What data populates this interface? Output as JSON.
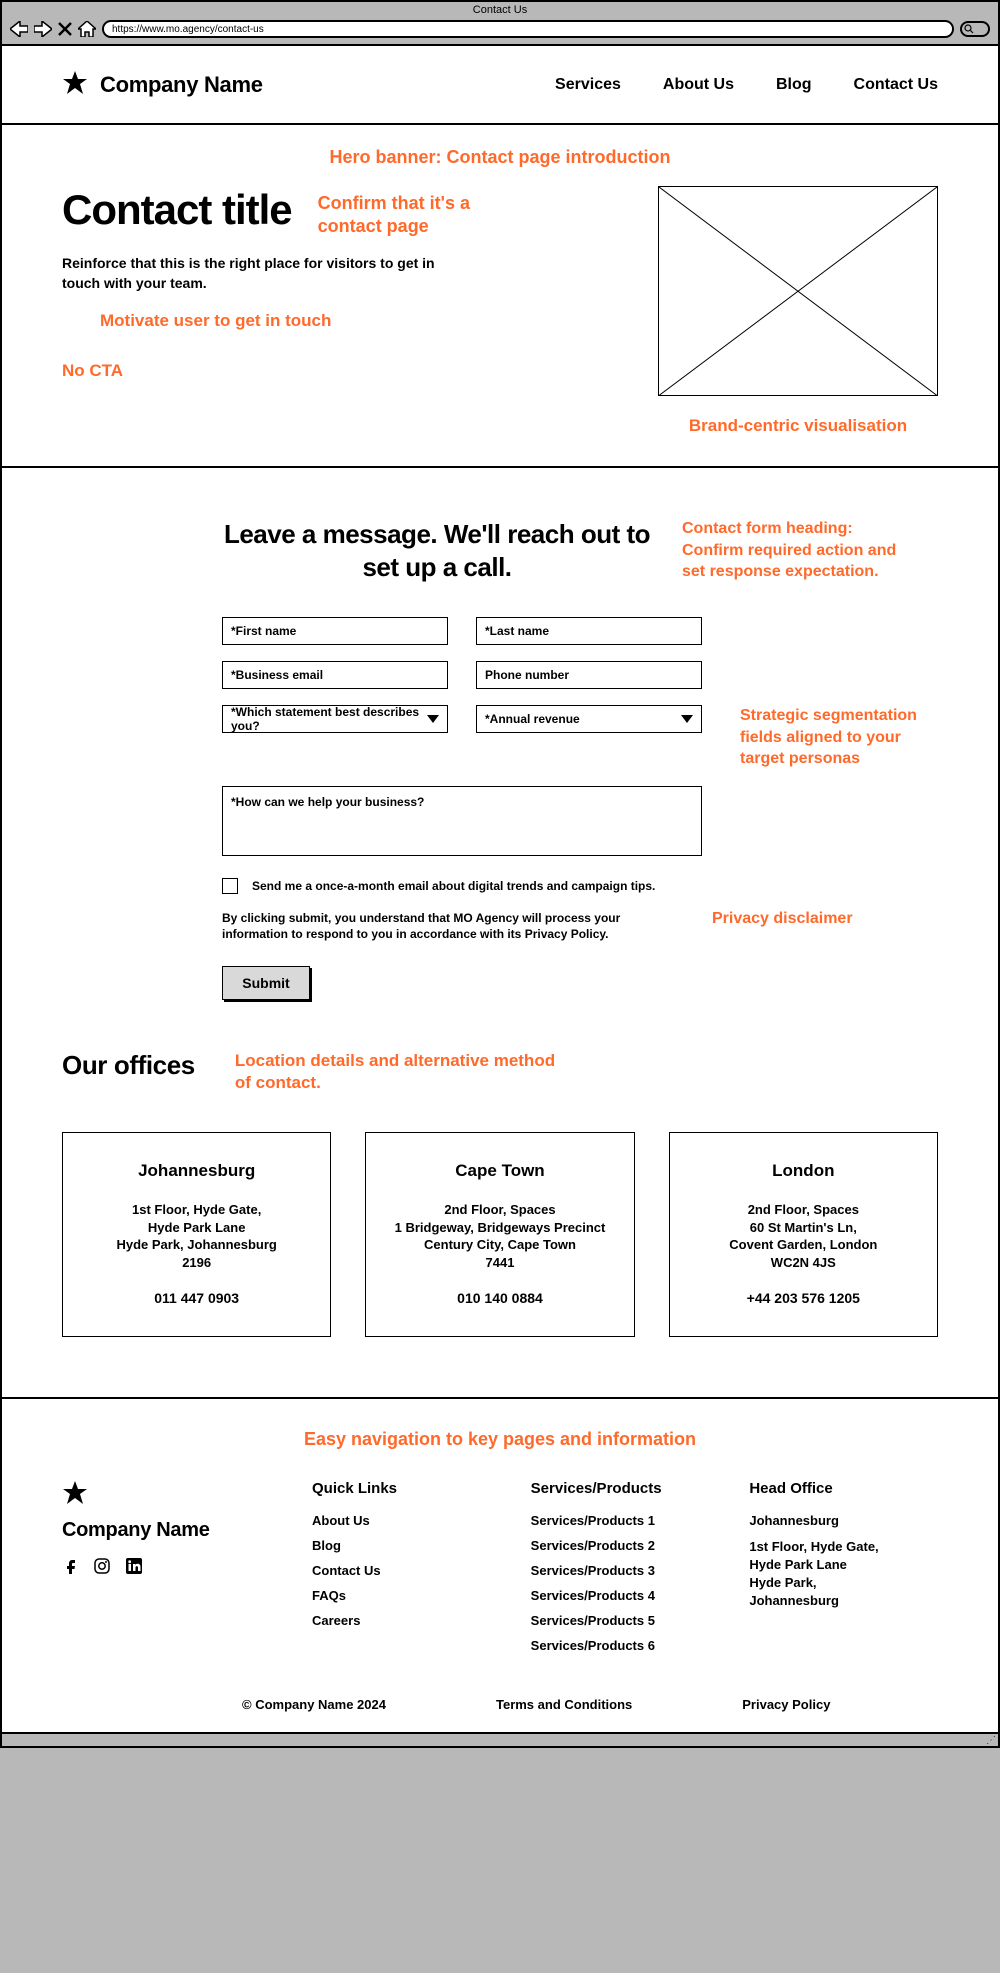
{
  "browser": {
    "tab_title": "Contact Us",
    "url": "https://www.mo.agency/contact-us"
  },
  "header": {
    "brand": "Company Name",
    "nav": [
      "Services",
      "About Us",
      "Blog",
      "Contact Us"
    ]
  },
  "hero": {
    "top_annotation": "Hero banner: Contact page introduction",
    "title": "Contact title",
    "title_annotation": "Confirm that it's a contact page",
    "description": "Reinforce that this is the right place for visitors to get in touch with your team.",
    "motivate_annotation": "Motivate user to get in touch",
    "no_cta_annotation": "No CTA",
    "image_annotation": "Brand-centric visualisation"
  },
  "form": {
    "heading": "Leave a message. We'll reach out to set up a call.",
    "heading_annotation": "Contact form heading: Confirm required action and set response expectation.",
    "fields": {
      "first_name": "*First name",
      "last_name": "*Last name",
      "business_email": "*Business email",
      "phone": "Phone number",
      "describe_you": "*Which statement best describes you?",
      "annual_revenue": "*Annual revenue",
      "message": "*How can we help your business?"
    },
    "segmentation_annotation": "Strategic segmentation fields aligned to your target personas",
    "checkbox_label": "Send me a once-a-month email about digital trends and campaign tips.",
    "disclaimer": "By clicking submit, you understand that MO Agency will process your information to respond to you in accordance with its Privacy Policy.",
    "disclaimer_annotation": "Privacy disclaimer",
    "submit_label": "Submit"
  },
  "offices": {
    "title": "Our offices",
    "annotation": "Location details and alternative method of contact.",
    "cards": [
      {
        "city": "Johannesburg",
        "address": "1st Floor, Hyde Gate,\nHyde Park Lane\nHyde Park, Johannesburg\n2196",
        "phone": "011 447 0903"
      },
      {
        "city": "Cape Town",
        "address": "2nd Floor, Spaces\n1 Bridgeway, Bridgeways Precinct\nCentury City, Cape Town\n7441",
        "phone": "010 140 0884"
      },
      {
        "city": "London",
        "address": "2nd Floor, Spaces\n60 St Martin's Ln,\nCovent Garden, London\nWC2N 4JS",
        "phone": "+44 203 576 1205"
      }
    ]
  },
  "footer": {
    "annotation": "Easy navigation to key pages and information",
    "brand": "Company Name",
    "quick_links_title": "Quick Links",
    "quick_links": [
      "About Us",
      "Blog",
      "Contact Us",
      "FAQs",
      "Careers"
    ],
    "services_title": "Services/Products",
    "services": [
      "Services/Products 1",
      "Services/Products 2",
      "Services/Products 3",
      "Services/Products 4",
      "Services/Products 5",
      "Services/Products 6"
    ],
    "head_office_title": "Head Office",
    "head_office_city": "Johannesburg",
    "head_office_address": "1st Floor, Hyde Gate,\nHyde Park Lane\nHyde Park,\nJohannesburg",
    "copyright": "© Company Name 2024",
    "terms": "Terms and Conditions",
    "privacy": "Privacy Policy"
  }
}
